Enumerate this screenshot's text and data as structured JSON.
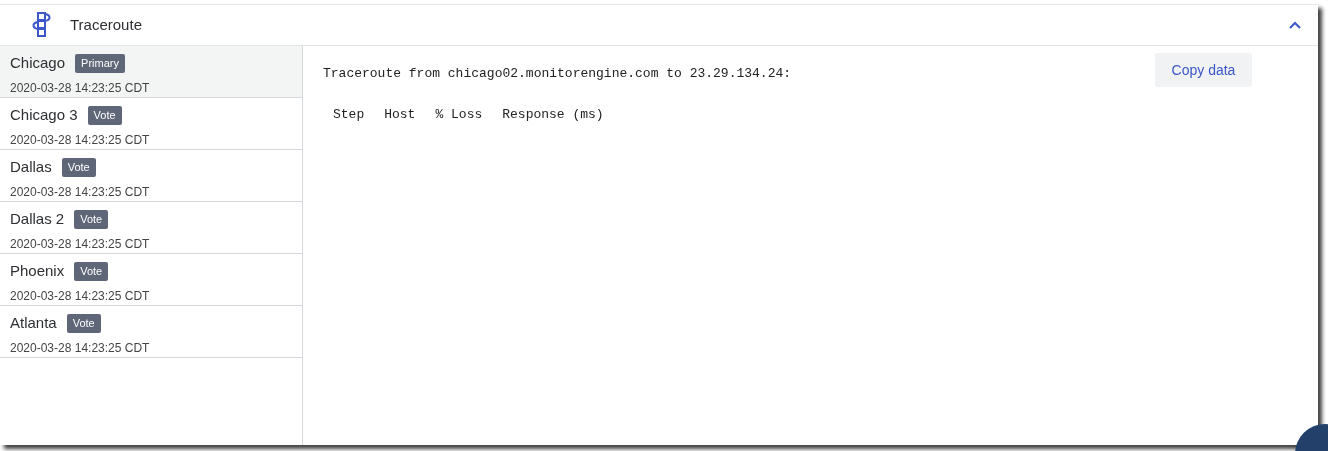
{
  "panel": {
    "title": "Traceroute",
    "expanded": true
  },
  "locations": [
    {
      "name": "Chicago",
      "badge": "Primary",
      "time": "2020-03-28 14:23:25 CDT",
      "selected": true
    },
    {
      "name": "Chicago 3",
      "badge": "Vote",
      "time": "2020-03-28 14:23:25 CDT",
      "selected": false
    },
    {
      "name": "Dallas",
      "badge": "Vote",
      "time": "2020-03-28 14:23:25 CDT",
      "selected": false
    },
    {
      "name": "Dallas 2",
      "badge": "Vote",
      "time": "2020-03-28 14:23:25 CDT",
      "selected": false
    },
    {
      "name": "Phoenix",
      "badge": "Vote",
      "time": "2020-03-28 14:23:25 CDT",
      "selected": false
    },
    {
      "name": "Atlanta",
      "badge": "Vote",
      "time": "2020-03-28 14:23:25 CDT",
      "selected": false
    }
  ],
  "output": {
    "heading": "Traceroute from chicago02.monitorengine.com to 23.29.134.24:",
    "columns": [
      "Step",
      "Host",
      "% Loss",
      "Response (ms)"
    ]
  },
  "copy_button": "Copy data"
}
